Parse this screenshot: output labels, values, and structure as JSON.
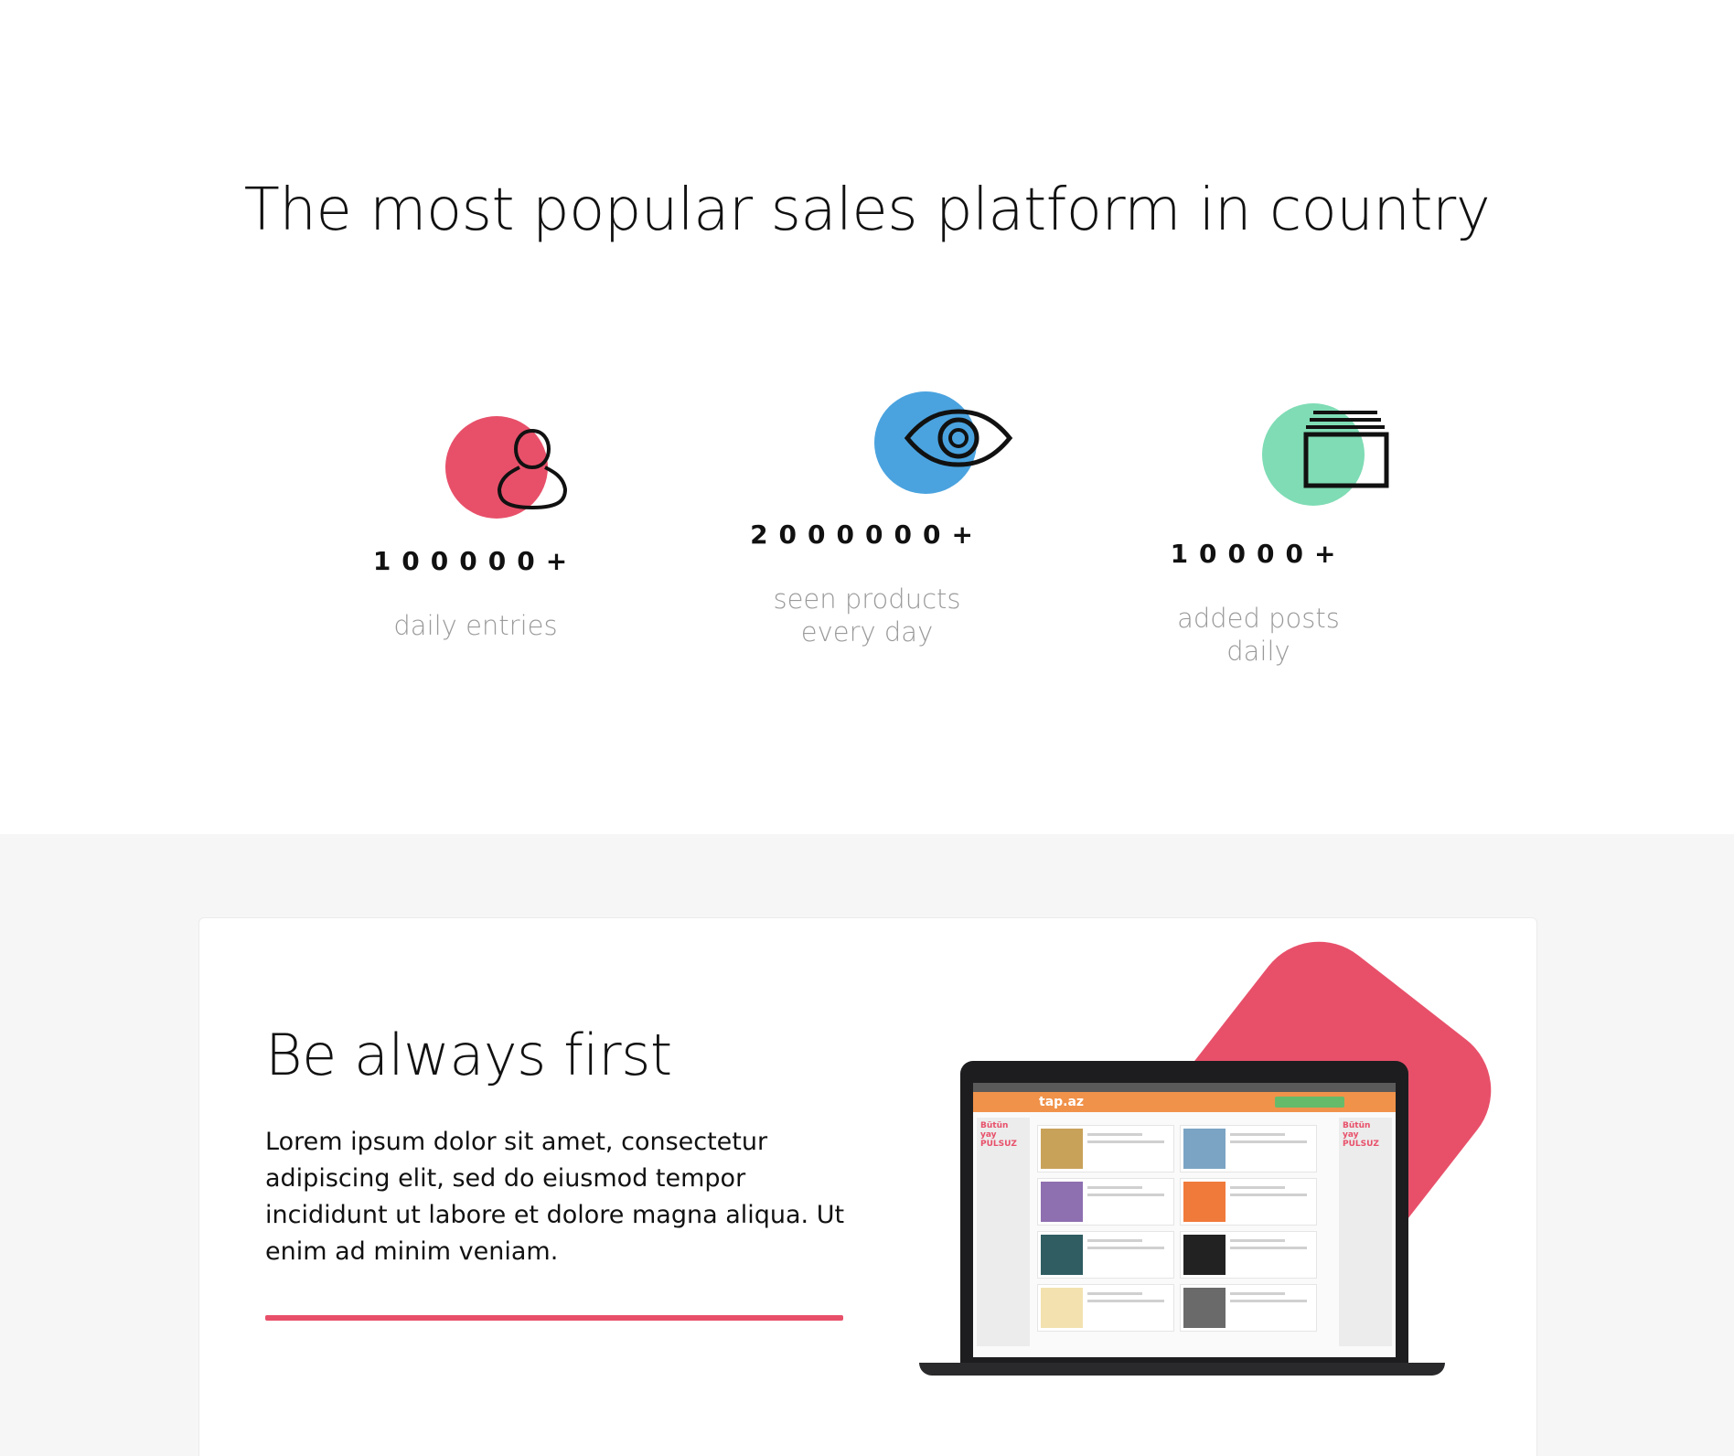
{
  "stats_section": {
    "headline": "The most popular sales platform in country",
    "stats": [
      {
        "icon": "user-icon",
        "color": "#e8506a",
        "value": "100000+",
        "label_lines": [
          "daily entries"
        ]
      },
      {
        "icon": "eye-icon",
        "color": "#4aa3df",
        "value": "2000000+",
        "label_lines": [
          "seen products",
          "every day"
        ]
      },
      {
        "icon": "posts-stack-icon",
        "color": "#7fdcb5",
        "value": "10000+",
        "label_lines": [
          "added posts",
          "daily"
        ]
      }
    ]
  },
  "feature_section": {
    "title": "Be always first",
    "text": "Lorem ipsum dolor sit amet, consectetur adipiscing elit, sed do eiusmod tempor incididunt ut labore et dolore magna aliqua. Ut enim ad minim veniam.",
    "accent_color": "#e8506a",
    "laptop_screen": {
      "logo": "tap.az",
      "promo_left": "Bütün yay PULSUZ",
      "promo_right": "Bütün yay PULSUZ"
    }
  }
}
